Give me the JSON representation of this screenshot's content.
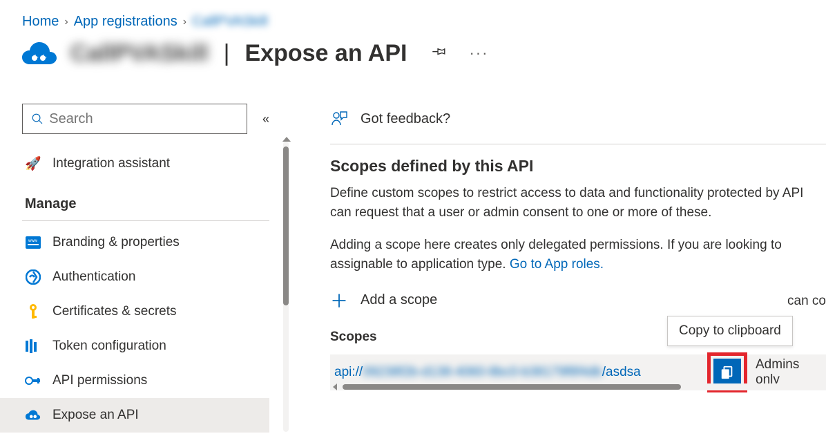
{
  "breadcrumb": {
    "home": "Home",
    "appreg": "App registrations",
    "current_blur": "CallPVASkill"
  },
  "header": {
    "app_name_blur": "CallPVASkill",
    "title": "Expose an API"
  },
  "sidebar": {
    "search_placeholder": "Search",
    "integration": "Integration assistant",
    "manage": "Manage",
    "branding": "Branding & properties",
    "auth": "Authentication",
    "certs": "Certificates & secrets",
    "token": "Token configuration",
    "apiperm": "API permissions",
    "expose": "Expose an API"
  },
  "main": {
    "feedback": "Got feedback?",
    "scopes_title": "Scopes defined by this API",
    "desc1": "Define custom scopes to restrict access to data and functionality protected by API can request that a user or admin consent to one or more of these.",
    "desc2_a": "Adding a scope here creates only delegated permissions. If you are looking to assignable to application type. ",
    "desc2_link": "Go to App roles.",
    "add_scope": "Add a scope",
    "scopes_col": "Scopes",
    "consent_col": "can co",
    "scope_uri_prefix": "api://",
    "scope_uri_blur": "09238f2b-d138-4060-8bc0-b38179f8f4db",
    "scope_uri_suffix": "/asdsa",
    "consent_val": "Admins only",
    "tooltip": "Copy to clipboard"
  }
}
